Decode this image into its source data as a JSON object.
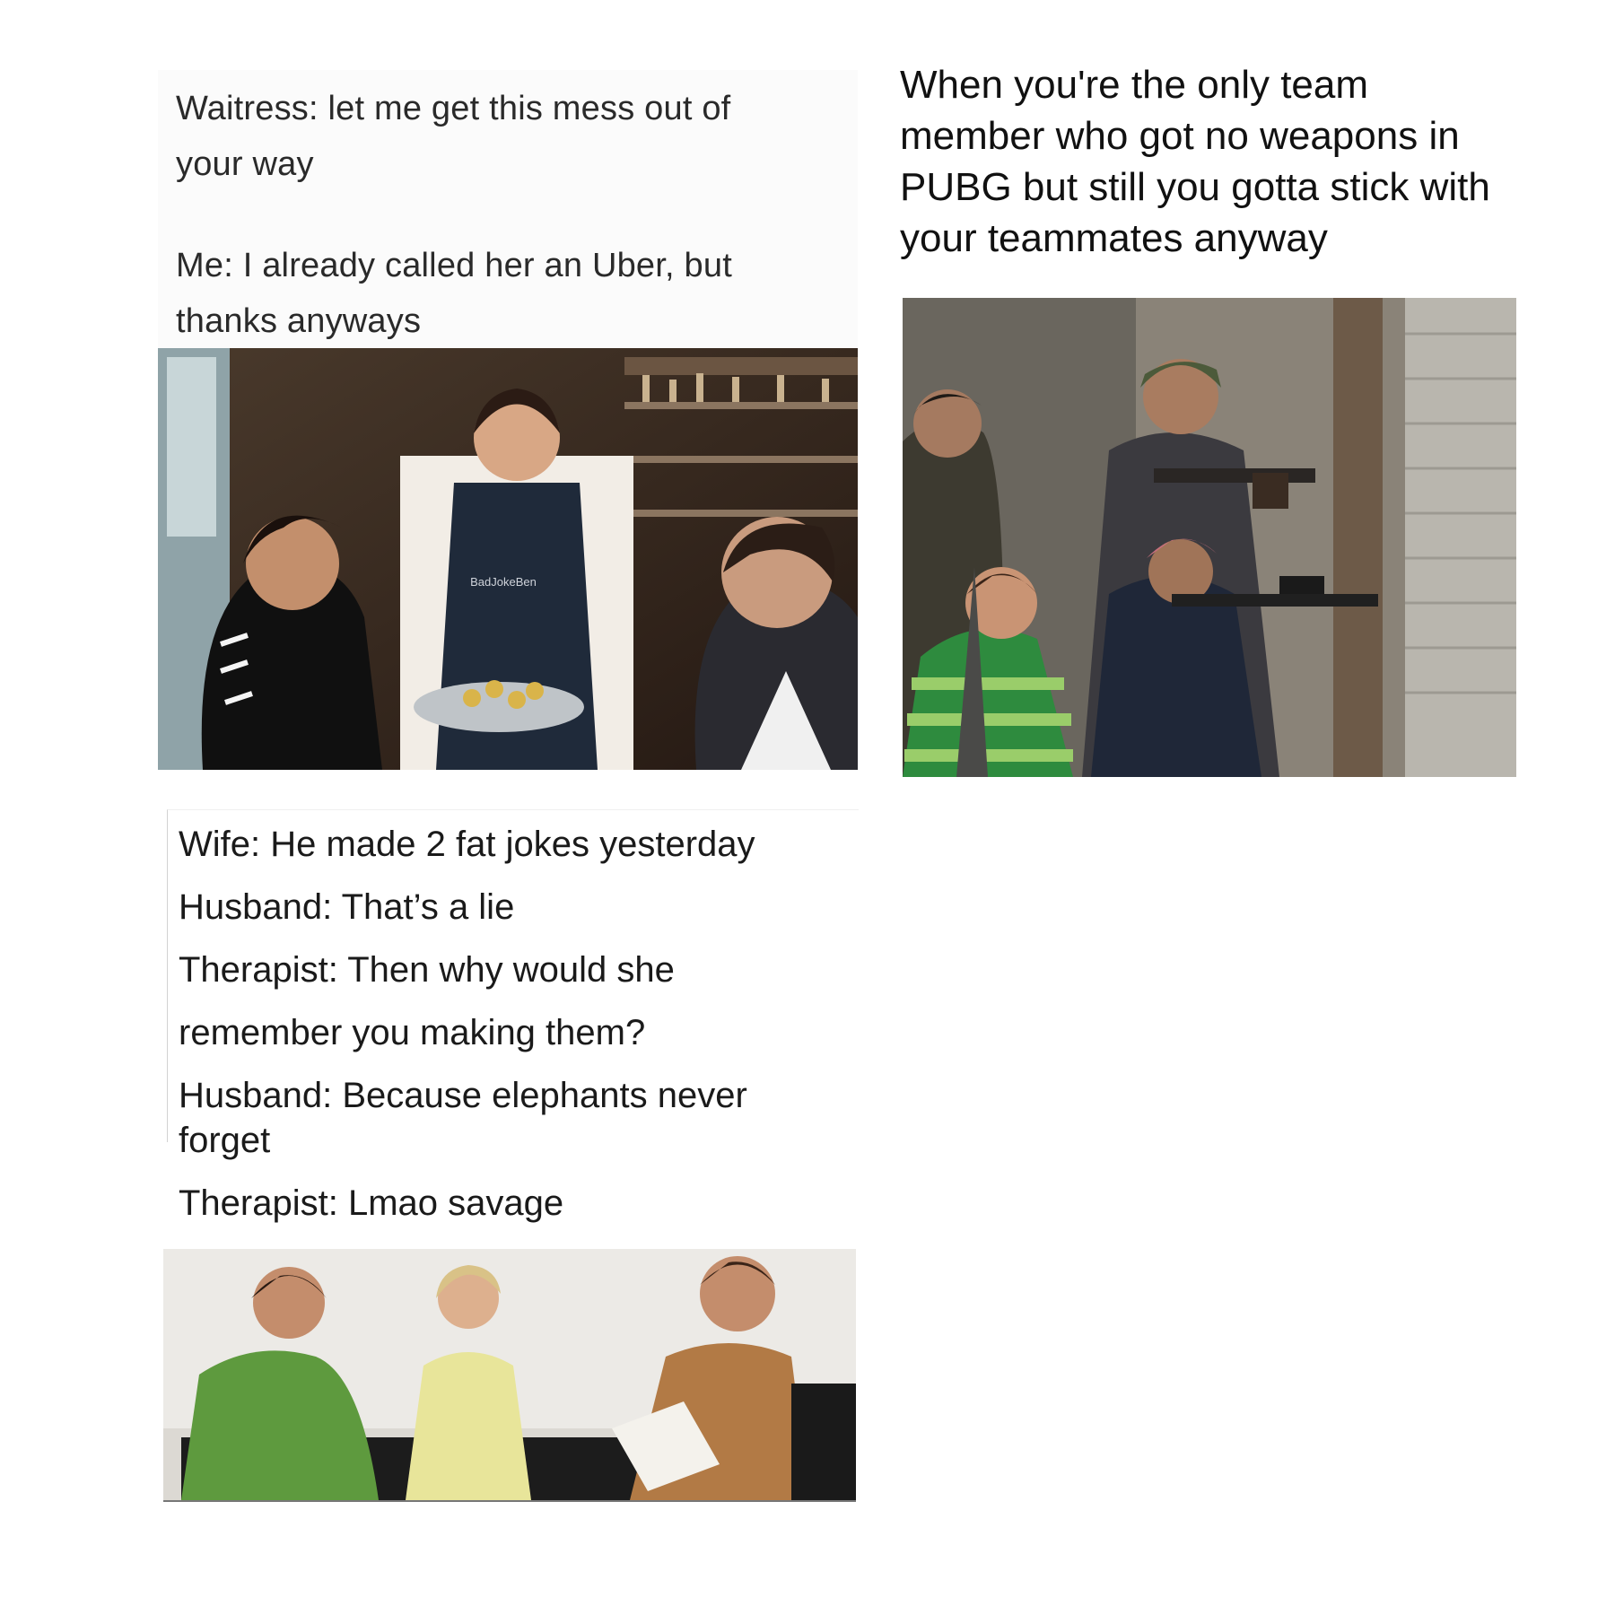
{
  "memes": [
    {
      "lines": [
        "Waitress: let me get this mess out of",
        "your way",
        "Me: I already called her an Uber, but",
        "thanks anyways"
      ],
      "photo": {
        "watermark": "BadJokeBen"
      }
    },
    {
      "lines": [
        "When you're the only team",
        "member who got no weapons in",
        "PUBG but still you gotta stick with",
        "your teammates anyway"
      ]
    },
    {
      "lines": [
        "Wife: He made 2 fat jokes yesterday",
        "Husband: That’s a lie",
        "Therapist: Then why would she",
        "remember you making them?",
        "Husband: Because elephants never",
        "forget",
        "Therapist: Lmao savage"
      ]
    }
  ],
  "colors": {
    "background": "#ffffff",
    "restaurant_wall": "#3a2a1e",
    "street_wall": "#8a8378",
    "office_wall": "#eceae6",
    "green_stripe": "#2e8b3e"
  }
}
